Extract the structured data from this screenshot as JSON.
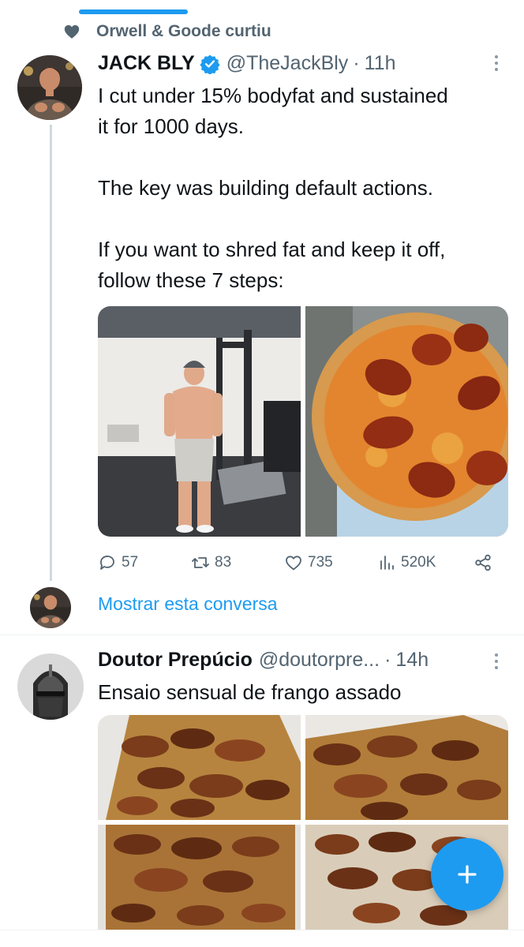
{
  "colors": {
    "accent": "#1d9bf0",
    "text_primary": "#0f1419",
    "text_secondary": "#536471",
    "divider": "#eff3f4"
  },
  "timeline": [
    {
      "social_context": {
        "icon": "heart-icon",
        "text": "Orwell & Goode curtiu"
      },
      "author": {
        "name": "JACK BLY",
        "handle": "@TheJackBly",
        "verified": true
      },
      "separator": "·",
      "time": "11h",
      "text_lines": [
        "I cut under 15% bodyfat and sustained",
        "it for 1000 days.",
        "",
        "The key was building default actions.",
        "",
        "If you want to shred fat and keep it off,",
        "follow these 7 steps:"
      ],
      "media": [
        {
          "kind": "gym-photo"
        },
        {
          "kind": "pizza-photo"
        }
      ],
      "actions": {
        "replies": "57",
        "retweets": "83",
        "likes": "735",
        "views": "520K"
      },
      "show_conversation": "Mostrar esta conversa"
    },
    {
      "author": {
        "name": "Doutor Prepúcio",
        "handle": "@doutorpre...",
        "verified": false
      },
      "separator": "·",
      "time": "14h",
      "text": "Ensaio sensual de frango assado",
      "media": [
        {
          "kind": "chicken-photo"
        },
        {
          "kind": "chicken-photo"
        },
        {
          "kind": "chicken-photo"
        },
        {
          "kind": "chicken-photo"
        }
      ]
    }
  ],
  "fab": {
    "icon": "plus-icon"
  }
}
